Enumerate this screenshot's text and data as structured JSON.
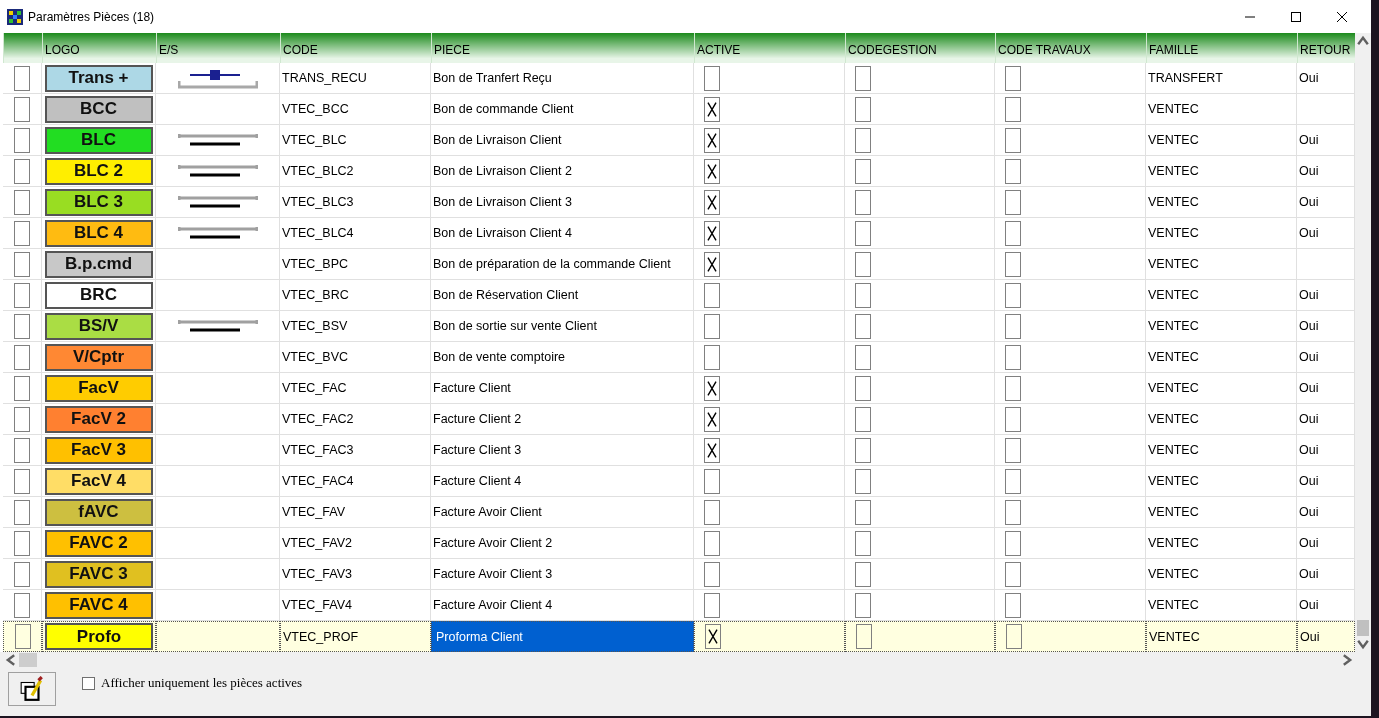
{
  "window": {
    "title": "Paramètres Pièces (18)"
  },
  "table": {
    "columns": [
      "LOGO",
      "E/S",
      "CODE",
      "PIECE",
      "ACTIVE",
      "CODEGESTION",
      "CODE TRAVAUX",
      "FAMILLE",
      "RETOUR"
    ],
    "rows": [
      {
        "selected": false,
        "checked": false,
        "logo": {
          "text": "Trans +",
          "color": "#add8e6"
        },
        "kind": "entree",
        "code": "TRANS_RECU",
        "piece": "Bon de Tranfert Reçu",
        "active": false,
        "codegestion": false,
        "code_travaux": false,
        "famille": "TRANSFERT",
        "retour": "Oui"
      },
      {
        "selected": false,
        "checked": false,
        "logo": {
          "text": "BCC",
          "color": "#c0c0c0"
        },
        "kind": "vide",
        "code": "VTEC_BCC",
        "piece": "Bon de commande Client",
        "active": true,
        "codegestion": false,
        "code_travaux": false,
        "famille": "VENTEC"
      },
      {
        "selected": false,
        "checked": false,
        "logo": {
          "text": "BLC",
          "color": "#22dd22"
        },
        "kind": "sortie",
        "code": "VTEC_BLC",
        "piece": "Bon de Livraison Client",
        "active": true,
        "codegestion": false,
        "code_travaux": false,
        "famille": "VENTEC",
        "retour": "Oui"
      },
      {
        "selected": false,
        "checked": false,
        "logo": {
          "text": "BLC 2",
          "color": "#ffee00"
        },
        "kind": "sortie",
        "code": "VTEC_BLC2",
        "piece": "Bon de Livraison Client 2",
        "active": true,
        "codegestion": false,
        "code_travaux": false,
        "famille": "VENTEC",
        "retour": "Oui"
      },
      {
        "selected": false,
        "checked": false,
        "logo": {
          "text": "BLC 3",
          "color": "#99dd22"
        },
        "kind": "sortie",
        "code": "VTEC_BLC3",
        "piece": "Bon de Livraison Client 3",
        "active": true,
        "codegestion": false,
        "code_travaux": false,
        "famille": "VENTEC",
        "retour": "Oui"
      },
      {
        "selected": false,
        "checked": false,
        "logo": {
          "text": "BLC 4",
          "color": "#ffbb11"
        },
        "kind": "sortie",
        "code": "VTEC_BLC4",
        "piece": "Bon de Livraison Client 4",
        "active": true,
        "codegestion": false,
        "code_travaux": false,
        "famille": "VENTEC",
        "retour": "Oui"
      },
      {
        "selected": false,
        "checked": false,
        "logo": {
          "text": "B.p.cmd",
          "color": "#c8c8c8"
        },
        "kind": "vide",
        "code": "VTEC_BPC",
        "piece": "Bon de préparation de la commande Client",
        "active": true,
        "codegestion": false,
        "code_travaux": false,
        "famille": "VENTEC"
      },
      {
        "selected": false,
        "checked": false,
        "logo": {
          "text": "BRC",
          "color": "#ffffff"
        },
        "kind": "vide",
        "code": "VTEC_BRC",
        "piece": "Bon de Réservation Client",
        "active": false,
        "codegestion": false,
        "code_travaux": false,
        "famille": "VENTEC",
        "retour": "Oui"
      },
      {
        "selected": false,
        "checked": false,
        "logo": {
          "text": "BS/V",
          "color": "#aadd44"
        },
        "kind": "sortie",
        "code": "VTEC_BSV",
        "piece": "Bon de sortie sur vente Client",
        "active": false,
        "codegestion": false,
        "code_travaux": false,
        "famille": "VENTEC",
        "retour": "Oui"
      },
      {
        "selected": false,
        "checked": false,
        "logo": {
          "text": "V/Cptr",
          "color": "#ff8833"
        },
        "kind": "vide",
        "code": "VTEC_BVC",
        "piece": "Bon de vente comptoire",
        "active": false,
        "codegestion": false,
        "code_travaux": false,
        "famille": "VENTEC",
        "retour": "Oui"
      },
      {
        "selected": false,
        "checked": false,
        "logo": {
          "text": "FacV",
          "color": "#ffcc00"
        },
        "kind": "vide",
        "code": "VTEC_FAC",
        "piece": "Facture Client",
        "active": true,
        "codegestion": false,
        "code_travaux": false,
        "famille": "VENTEC",
        "retour": "Oui"
      },
      {
        "selected": false,
        "checked": false,
        "logo": {
          "text": "FacV 2",
          "color": "#ff8030"
        },
        "kind": "vide",
        "code": "VTEC_FAC2",
        "piece": "Facture Client 2",
        "active": true,
        "codegestion": false,
        "code_travaux": false,
        "famille": "VENTEC",
        "retour": "Oui"
      },
      {
        "selected": false,
        "checked": false,
        "logo": {
          "text": "FacV 3",
          "color": "#ffc000"
        },
        "kind": "vide",
        "code": "VTEC_FAC3",
        "piece": "Facture Client 3",
        "active": true,
        "codegestion": false,
        "code_travaux": false,
        "famille": "VENTEC",
        "retour": "Oui"
      },
      {
        "selected": false,
        "checked": false,
        "logo": {
          "text": "FacV 4",
          "color": "#ffdd66"
        },
        "kind": "vide",
        "code": "VTEC_FAC4",
        "piece": "Facture Client 4",
        "active": false,
        "codegestion": false,
        "code_travaux": false,
        "famille": "VENTEC",
        "retour": "Oui"
      },
      {
        "selected": false,
        "checked": false,
        "logo": {
          "text": "fAVC",
          "color": "#cdbf40"
        },
        "kind": "vide",
        "code": "VTEC_FAV",
        "piece": "Facture Avoir Client",
        "active": false,
        "codegestion": false,
        "code_travaux": false,
        "famille": "VENTEC",
        "retour": "Oui"
      },
      {
        "selected": false,
        "checked": false,
        "logo": {
          "text": "FAVC 2",
          "color": "#ffc000"
        },
        "kind": "vide",
        "code": "VTEC_FAV2",
        "piece": "Facture Avoir Client 2",
        "active": false,
        "codegestion": false,
        "code_travaux": false,
        "famille": "VENTEC",
        "retour": "Oui"
      },
      {
        "selected": false,
        "checked": false,
        "logo": {
          "text": "FAVC 3",
          "color": "#e0c020"
        },
        "kind": "vide",
        "code": "VTEC_FAV3",
        "piece": "Facture Avoir Client 3",
        "active": false,
        "codegestion": false,
        "code_travaux": false,
        "famille": "VENTEC",
        "retour": "Oui"
      },
      {
        "selected": false,
        "checked": false,
        "logo": {
          "text": "FAVC 4",
          "color": "#ffc000"
        },
        "kind": "vide",
        "code": "VTEC_FAV4",
        "piece": "Facture Avoir Client 4",
        "active": false,
        "codegestion": false,
        "code_travaux": false,
        "famille": "VENTEC",
        "retour": "Oui"
      },
      {
        "selected": true,
        "checked": false,
        "logo": {
          "text": "Profo",
          "color": "#ffff00"
        },
        "kind": "vide",
        "code": "VTEC_PROF",
        "piece": "Proforma Client",
        "active": true,
        "codegestion": false,
        "code_travaux": false,
        "famille": "VENTEC",
        "retour": "Oui"
      }
    ]
  },
  "footer": {
    "filter": {
      "label": "Afficher uniquement les pièces actives",
      "checked": false
    }
  }
}
